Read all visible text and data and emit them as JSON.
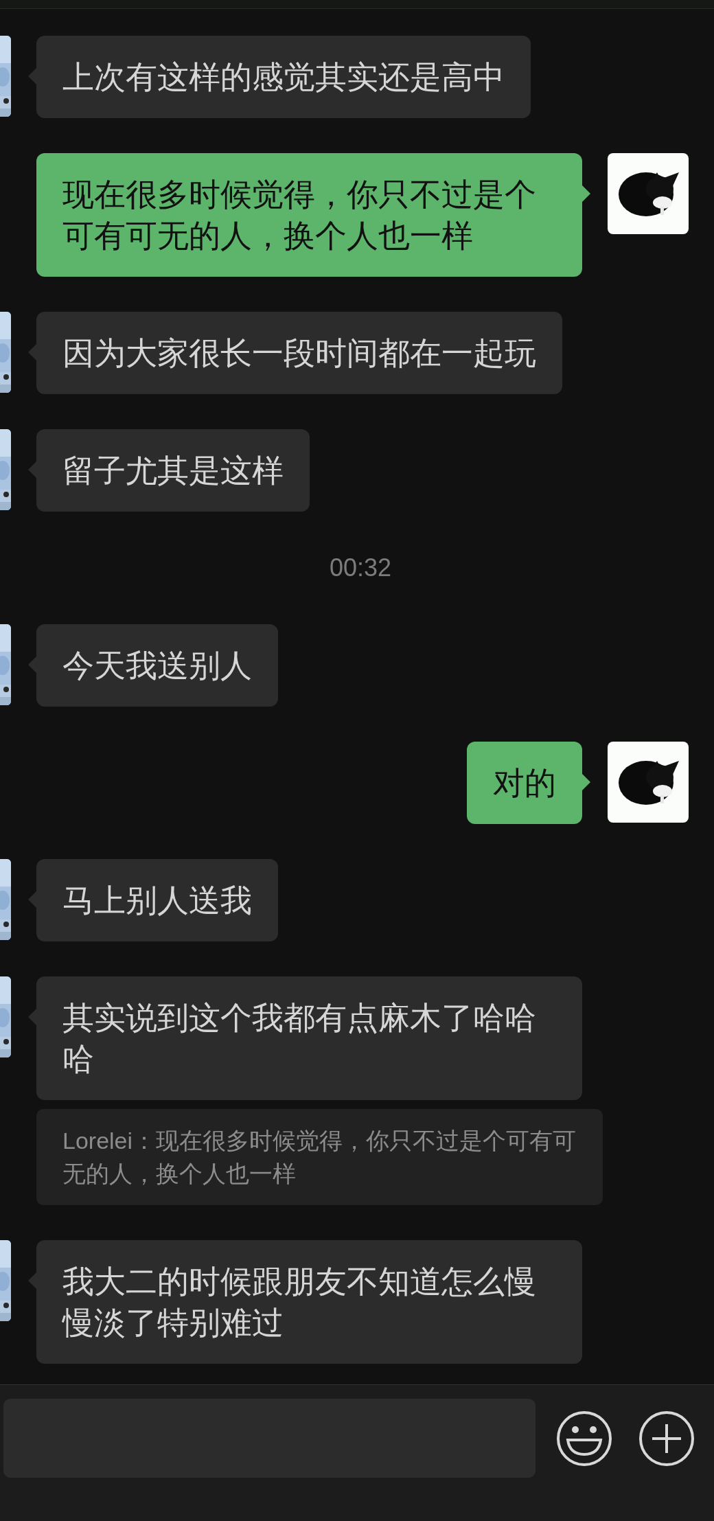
{
  "messages": [
    {
      "kind": "received",
      "text": "上次有这样的感觉其实还是高中"
    },
    {
      "kind": "sent",
      "text": "现在很多时候觉得，你只不过是个可有可无的人，换个人也一样"
    },
    {
      "kind": "received",
      "text": "因为大家很长一段时间都在一起玩"
    },
    {
      "kind": "received",
      "text": "留子尤其是这样"
    },
    {
      "kind": "time",
      "text": "00:32"
    },
    {
      "kind": "received",
      "text": "今天我送别人"
    },
    {
      "kind": "sent",
      "text": "对的"
    },
    {
      "kind": "received",
      "text": "马上别人送我"
    },
    {
      "kind": "received",
      "text": "其实说到这个我都有点麻木了哈哈哈",
      "quote": "Lorelei：现在很多时候觉得，你只不过是个可有可无的人，换个人也一样"
    },
    {
      "kind": "received",
      "text": "我大二的时候跟朋友不知道怎么慢慢淡了特别难过"
    }
  ]
}
